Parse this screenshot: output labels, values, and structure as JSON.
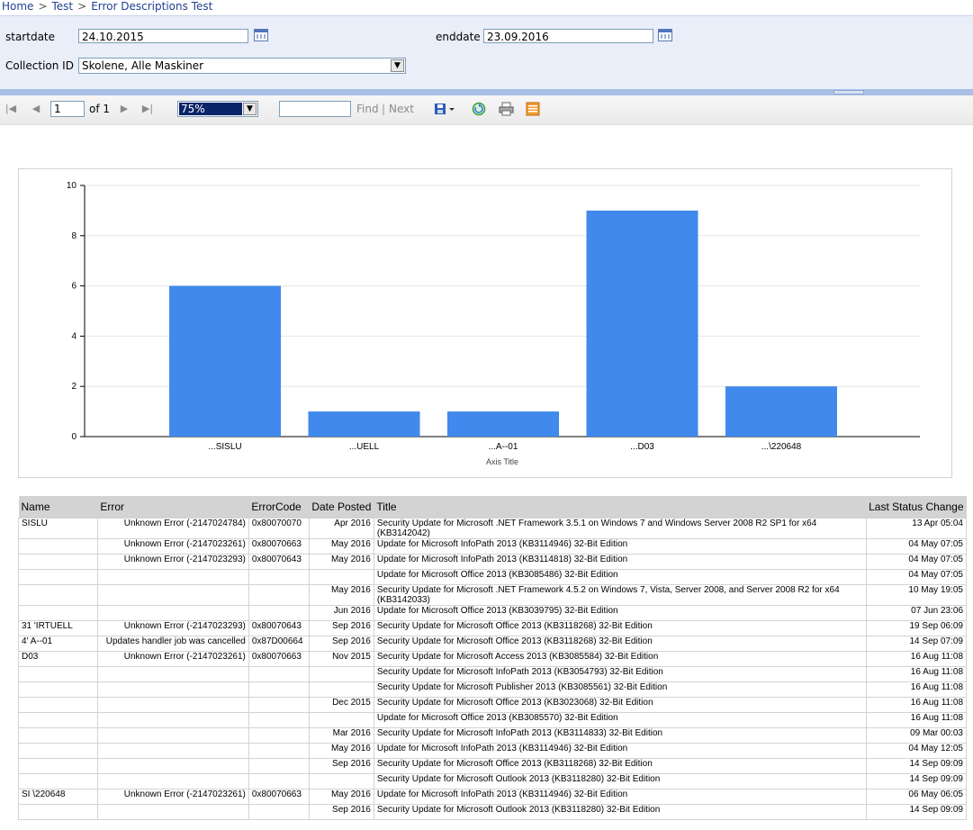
{
  "breadcrumb": {
    "items": [
      "Home",
      "Test",
      "Error Descriptions Test"
    ],
    "separator": ">"
  },
  "params": {
    "startdate_label": "startdate",
    "startdate_value": "24.10.2015",
    "enddate_label": "enddate",
    "enddate_value": "23.09.2016",
    "collection_label": "Collection ID",
    "collection_value": "Skolene, Alle Maskiner"
  },
  "toolbar": {
    "page_value": "1",
    "page_of": "of 1",
    "zoom_value": "75%",
    "find_label": "Find",
    "separator": "|",
    "next_label": "Next"
  },
  "chart_data": {
    "type": "bar",
    "categories": [
      "...SISLU",
      "...UELL",
      "...A--01",
      "...D03",
      "...\\220648"
    ],
    "values": [
      6,
      1,
      1,
      9,
      2
    ],
    "xlabel": "Axis Title",
    "ylabel": "",
    "ylim": [
      0,
      10
    ],
    "yticks": [
      0,
      2,
      4,
      6,
      8,
      10
    ],
    "grid": true,
    "color": "#4189ec"
  },
  "table": {
    "headers": [
      "Name",
      "Error",
      "ErrorCode",
      "Date Posted",
      "Title",
      "Last Status Change"
    ],
    "rows": [
      {
        "name": "SISLU",
        "error": "Unknown Error (-2147024784)",
        "code": "0x80070070",
        "date": "Apr 2016",
        "title": "Security Update for Microsoft .NET Framework 3.5.1 on Windows 7 and Windows Server 2008 R2 SP1 for x64 (KB3142042)",
        "status": "13 Apr 05:04"
      },
      {
        "name": "",
        "error": "Unknown Error (-2147023261)",
        "code": "0x80070663",
        "date": "May 2016",
        "title": "Update for Microsoft InfoPath 2013 (KB3114946) 32-Bit Edition",
        "status": "04 May 07:05"
      },
      {
        "name": "",
        "error": "Unknown Error (-2147023293)",
        "code": "0x80070643",
        "date": "May 2016",
        "title": "Update for Microsoft InfoPath 2013 (KB3114818) 32-Bit Edition",
        "status": "04 May 07:05"
      },
      {
        "name": "",
        "error": "",
        "code": "",
        "date": "",
        "title": "Update for Microsoft Office 2013 (KB3085486) 32-Bit Edition",
        "status": "04 May 07:05"
      },
      {
        "name": "",
        "error": "",
        "code": "",
        "date": "May 2016",
        "title": "Security Update for Microsoft .NET Framework 4.5.2 on Windows 7, Vista, Server 2008, and Server 2008 R2 for x64 (KB3142033)",
        "status": "10 May 19:05"
      },
      {
        "name": "",
        "error": "",
        "code": "",
        "date": "Jun 2016",
        "title": "Update for Microsoft Office 2013 (KB3039795) 32-Bit Edition",
        "status": "07 Jun 23:06"
      },
      {
        "name": "31 'IRTUELL",
        "error": "Unknown Error (-2147023293)",
        "code": "0x80070643",
        "date": "Sep 2016",
        "title": "Security Update for Microsoft Office 2013 (KB3118268) 32-Bit Edition",
        "status": "19 Sep 06:09"
      },
      {
        "name": "4' A--01",
        "error": "Updates handler job was cancelled",
        "code": "0x87D00664",
        "date": "Sep 2016",
        "title": "Security Update for Microsoft Office 2013 (KB3118268) 32-Bit Edition",
        "status": "14 Sep 07:09"
      },
      {
        "name": "D03",
        "error": "Unknown Error (-2147023261)",
        "code": "0x80070663",
        "date": "Nov 2015",
        "title": "Security Update for Microsoft Access 2013 (KB3085584) 32-Bit Edition",
        "status": "16 Aug 11:08"
      },
      {
        "name": "",
        "error": "",
        "code": "",
        "date": "",
        "title": "Security Update for Microsoft InfoPath 2013 (KB3054793) 32-Bit Edition",
        "status": "16 Aug 11:08"
      },
      {
        "name": "",
        "error": "",
        "code": "",
        "date": "",
        "title": "Security Update for Microsoft Publisher 2013 (KB3085561) 32-Bit Edition",
        "status": "16 Aug 11:08"
      },
      {
        "name": "",
        "error": "",
        "code": "",
        "date": "Dec 2015",
        "title": "Security Update for Microsoft Office 2013 (KB3023068) 32-Bit Edition",
        "status": "16 Aug 11:08"
      },
      {
        "name": "",
        "error": "",
        "code": "",
        "date": "",
        "title": "Update for Microsoft Office 2013 (KB3085570) 32-Bit Edition",
        "status": "16 Aug 11:08"
      },
      {
        "name": "",
        "error": "",
        "code": "",
        "date": "Mar 2016",
        "title": "Security Update for Microsoft InfoPath 2013 (KB3114833) 32-Bit Edition",
        "status": "09 Mar 00:03"
      },
      {
        "name": "",
        "error": "",
        "code": "",
        "date": "May 2016",
        "title": "Update for Microsoft InfoPath 2013 (KB3114946) 32-Bit Edition",
        "status": "04 May 12:05"
      },
      {
        "name": "",
        "error": "",
        "code": "",
        "date": "Sep 2016",
        "title": "Security Update for Microsoft Office 2013 (KB3118268) 32-Bit Edition",
        "status": "14 Sep 09:09"
      },
      {
        "name": "",
        "error": "",
        "code": "",
        "date": "",
        "title": "Security Update for Microsoft Outlook 2013 (KB3118280) 32-Bit Edition",
        "status": "14 Sep 09:09"
      },
      {
        "name": "SI \\220648",
        "error": "Unknown Error (-2147023261)",
        "code": "0x80070663",
        "date": "May 2016",
        "title": "Update for Microsoft InfoPath 2013 (KB3114946) 32-Bit Edition",
        "status": "06 May 06:05"
      },
      {
        "name": "",
        "error": "",
        "code": "",
        "date": "Sep 2016",
        "title": "Security Update for Microsoft Outlook 2013 (KB3118280) 32-Bit Edition",
        "status": "14 Sep 09:09"
      }
    ]
  }
}
